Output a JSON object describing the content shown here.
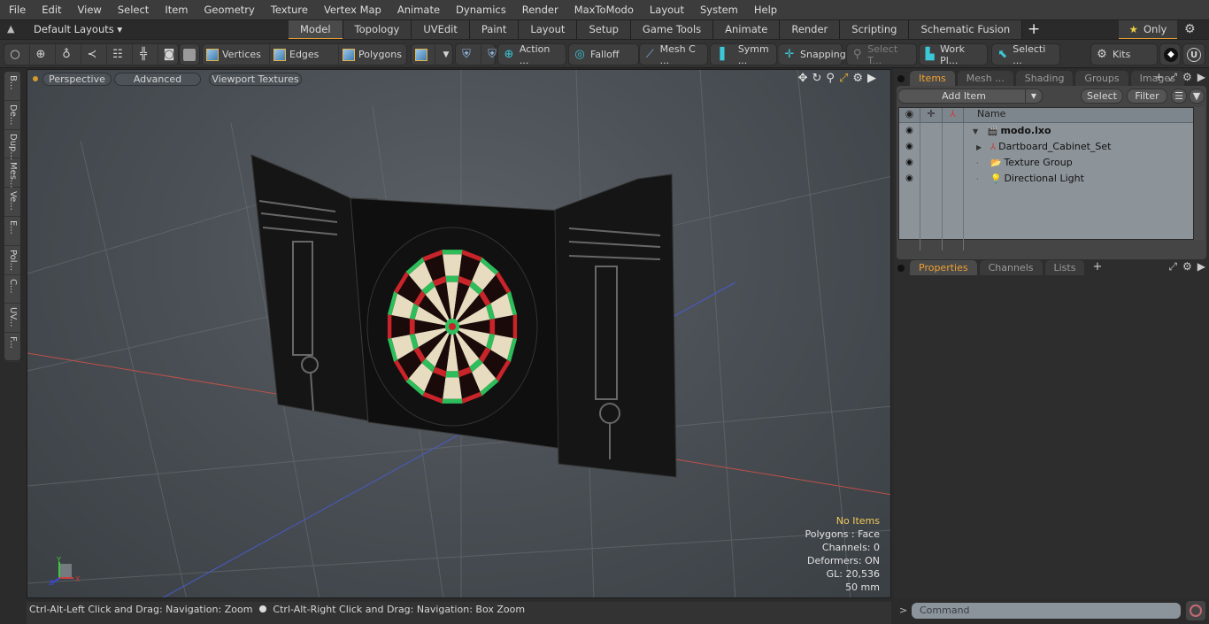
{
  "menu": [
    "File",
    "Edit",
    "View",
    "Select",
    "Item",
    "Geometry",
    "Texture",
    "Vertex Map",
    "Animate",
    "Dynamics",
    "Render",
    "MaxToModo",
    "Layout",
    "System",
    "Help"
  ],
  "layout_bar": {
    "layouts_label": "Default Layouts ▾",
    "tabs": [
      "Model",
      "Topology",
      "UVEdit",
      "Paint",
      "Layout",
      "Setup",
      "Game Tools",
      "Animate",
      "Render",
      "Scripting",
      "Schematic Fusion"
    ],
    "active_tab": "Model",
    "add_tab": "+",
    "only_label": "Only"
  },
  "toolbar": {
    "vertices": "Vertices",
    "edges": "Edges",
    "polygons": "Polygons",
    "action": "Action ...",
    "falloff": "Falloff",
    "mesh_c": "Mesh C ...",
    "symm": "Symm ...",
    "snapping": "Snapping",
    "select_t": "Select T...",
    "work_pl": "Work Pl...",
    "selecti": "Selecti ...",
    "kits": "Kits"
  },
  "left_tabs": [
    "B...",
    "De...",
    "Dup...",
    "Mes...",
    "Ve...",
    "E...",
    "Pol...",
    "C...",
    "UV...",
    "F..."
  ],
  "viewport": {
    "perspective": "Perspective",
    "advanced": "Advanced",
    "viewport_textures": "Viewport Textures",
    "hud": {
      "items": "No Items",
      "polygons": "Polygons : Face",
      "channels": "Channels: 0",
      "deformers": "Deformers: ON",
      "gl": "GL: 20,536",
      "unit": "50 mm"
    },
    "axis_labels": {
      "x": "X",
      "y": "Y",
      "z": "Z"
    }
  },
  "items_panel": {
    "tabs": [
      "Items",
      "Mesh ...",
      "Shading",
      "Groups",
      "Images"
    ],
    "active_tab": "Items",
    "add_item": "Add Item",
    "select": "Select",
    "filter": "Filter",
    "column_name": "Name",
    "tree": [
      {
        "name": "modo.lxo",
        "level": 0,
        "icon": "scene-icon",
        "expanded": true,
        "bold": true
      },
      {
        "name": "Dartboard_Cabinet_Set",
        "level": 1,
        "icon": "locator-icon",
        "expanded": false
      },
      {
        "name": "Texture Group",
        "level": 1,
        "icon": "folder-icon"
      },
      {
        "name": "Directional Light",
        "level": 1,
        "icon": "light-icon"
      }
    ]
  },
  "properties_panel": {
    "tabs": [
      "Properties",
      "Channels",
      "Lists"
    ],
    "active_tab": "Properties"
  },
  "command": {
    "prompt": ">",
    "placeholder": "Command"
  },
  "status_bar": {
    "left": "Ctrl-Alt-Left Click and Drag: Navigation: Zoom",
    "right": "Ctrl-Alt-Right Click and Drag: Navigation: Box Zoom"
  }
}
